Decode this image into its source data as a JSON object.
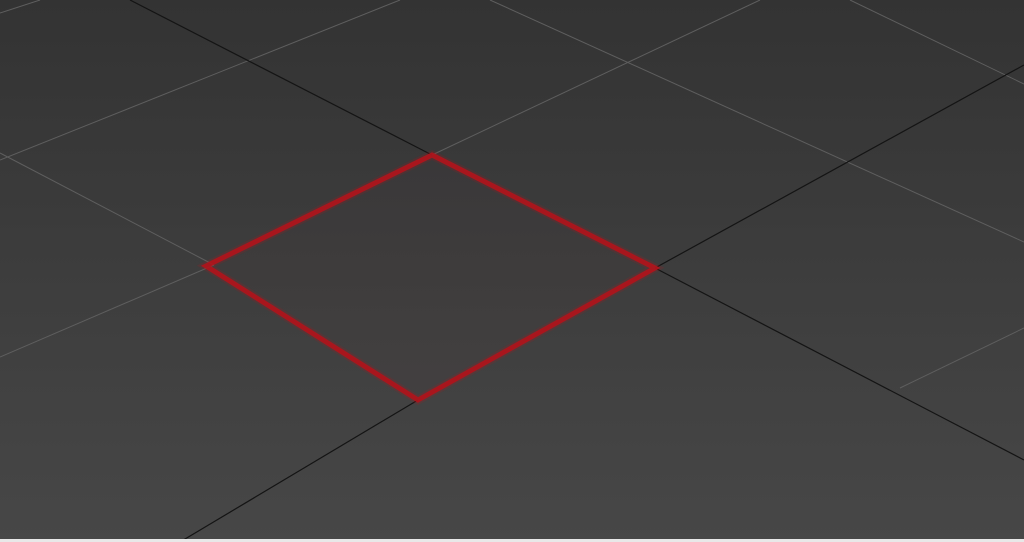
{
  "viewport": {
    "projection": "perspective",
    "background_colors": {
      "far": "#333333",
      "near": "#474747"
    },
    "grid": {
      "visible": true,
      "minor_line_color": "#5e5e5e",
      "major_line_color": "#141414"
    },
    "selection": {
      "element": "polygon-face",
      "highlight_color": "#b0141c"
    }
  }
}
